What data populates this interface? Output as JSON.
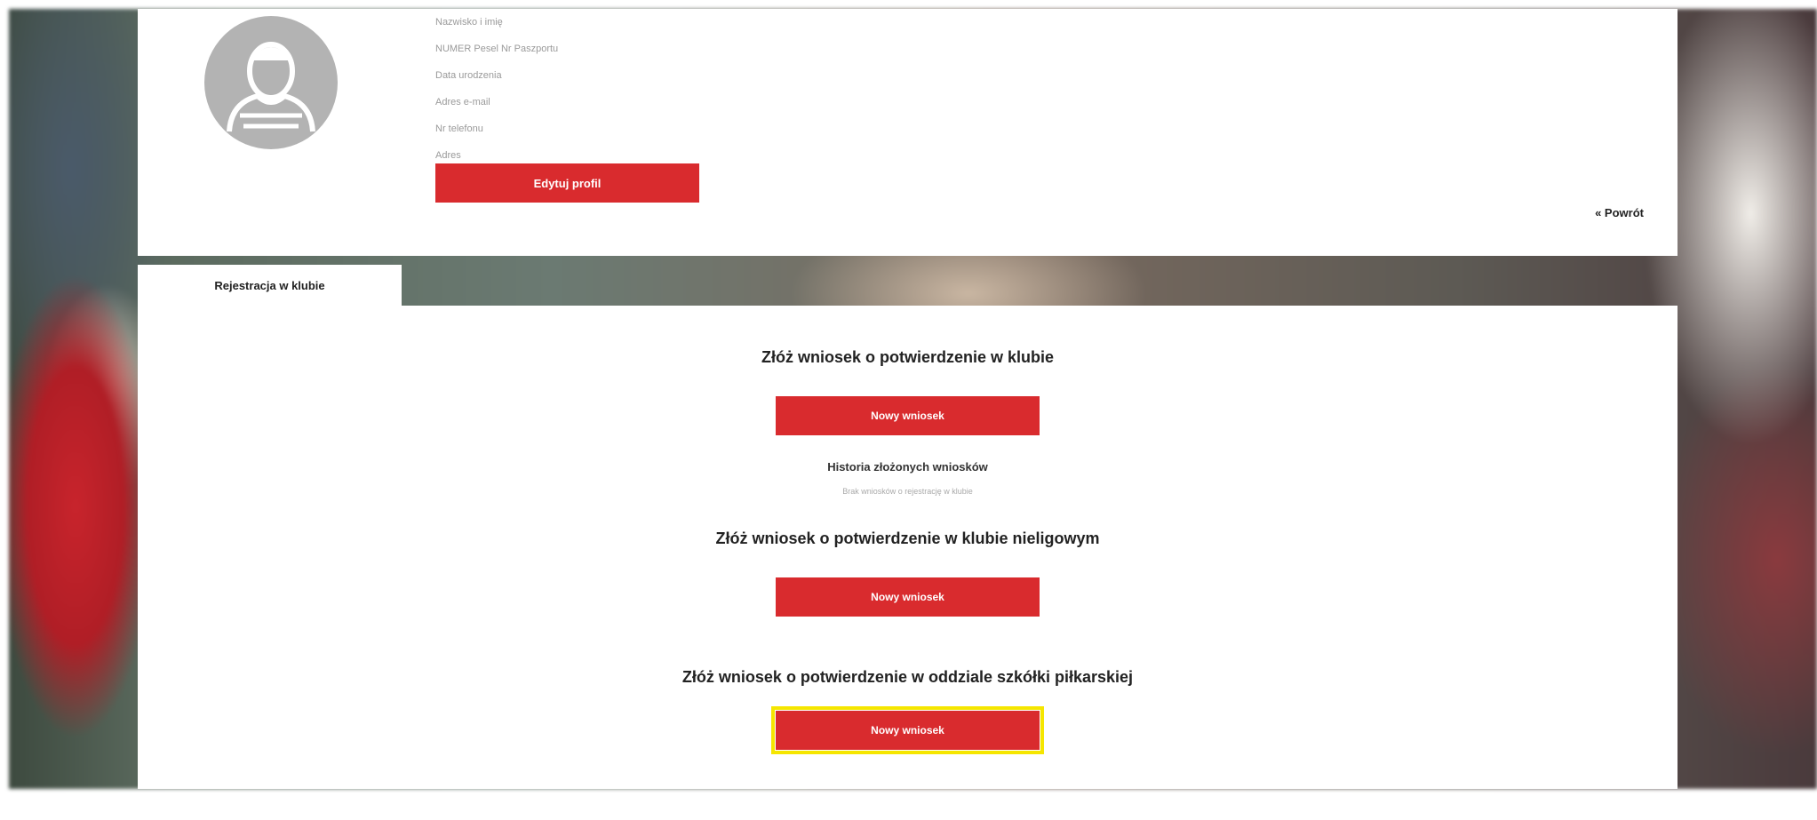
{
  "profile": {
    "fields": [
      "Nazwisko i imię",
      "NUMER Pesel Nr Paszportu",
      "Data urodzenia",
      "Adres e-mail",
      "Nr telefonu",
      "Adres"
    ],
    "edit_button": "Edytuj profil",
    "back_link": "« Powrót"
  },
  "tab": {
    "label": "Rejestracja w klubie"
  },
  "sections": {
    "club": {
      "heading": "Złóż wniosek o potwierdzenie w klubie",
      "button": "Nowy wniosek",
      "history_title": "Historia złożonych wniosków",
      "history_sub": "Brak wniosków o rejestrację w klubie"
    },
    "nonleague": {
      "heading": "Złóż wniosek o potwierdzenie w klubie nieligowym",
      "button": "Nowy wniosek"
    },
    "school": {
      "heading": "Złóż wniosek o potwierdzenie w oddziale  szkółki piłkarskiej",
      "button": "Nowy wniosek"
    }
  },
  "colors": {
    "accent": "#d92b2e",
    "highlight": "#f5e600"
  }
}
